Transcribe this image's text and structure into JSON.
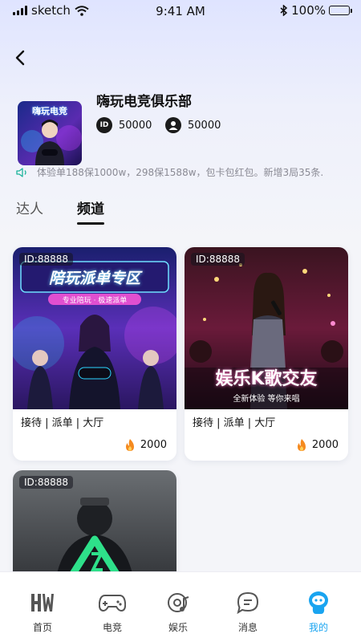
{
  "status_bar": {
    "carrier": "sketch",
    "time": "9:41 AM",
    "battery": "100%"
  },
  "club": {
    "name": "嗨玩电竞俱乐部",
    "avatar_title": "嗨玩电竞",
    "id_value": "50000",
    "fans_value": "50000"
  },
  "notice": {
    "text": "体验单188保1000w，298保1588w，包卡包红包。新增3局35条."
  },
  "tabs": [
    {
      "label": "达人"
    },
    {
      "label": "频道"
    }
  ],
  "cards": [
    {
      "id": "ID:88888",
      "banner": "陪玩派单专区",
      "subtitle": "专业陪玩 · 极速派单",
      "tags": "接待 | 派单 | 大厅",
      "count": "2000"
    },
    {
      "id": "ID:88888",
      "banner": "娱乐K歌交友",
      "subtitle": "全新体验 等你来唱",
      "tags": "接待 | 派单 | 大厅",
      "count": "2000"
    },
    {
      "id": "ID:88888"
    }
  ],
  "tabbar": [
    {
      "label": "首页",
      "icon": "home-icon"
    },
    {
      "label": "电竞",
      "icon": "gamepad-icon"
    },
    {
      "label": "娱乐",
      "icon": "music-disc-icon"
    },
    {
      "label": "消息",
      "icon": "chat-bubble-icon"
    },
    {
      "label": "我的",
      "icon": "profile-icon"
    }
  ],
  "colors": {
    "accent": "#19a4f0",
    "text": "#111111"
  }
}
